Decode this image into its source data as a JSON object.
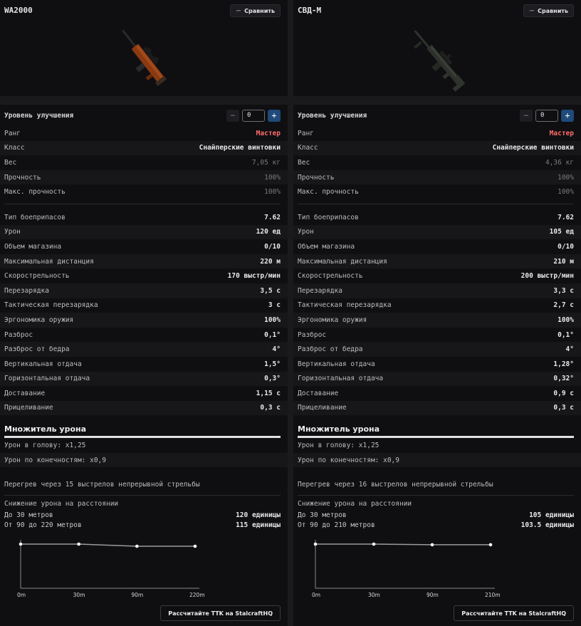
{
  "panels": [
    {
      "name": "WA2000",
      "compare_label": "Сравнить",
      "upgrade_label": "Уровень улучшения",
      "upgrade_value": "0",
      "rows_a": [
        {
          "label": "Ранг",
          "value": "Мастер",
          "kind": "rank"
        },
        {
          "label": "Класс",
          "value": "Снайперские винтовки",
          "kind": "bold"
        },
        {
          "label": "Вес",
          "value": "7,05 кг",
          "kind": "dim"
        },
        {
          "label": "Прочность",
          "value": "100%",
          "kind": "dim"
        },
        {
          "label": "Макс. прочность",
          "value": "100%",
          "kind": "dim"
        }
      ],
      "rows_b": [
        {
          "label": "Тип боеприпасов",
          "value": "7.62"
        },
        {
          "label": "Урон",
          "value": "120 ед"
        },
        {
          "label": "Объем магазина",
          "value": "0/10"
        },
        {
          "label": "Максимальная дистанция",
          "value": "220 м"
        },
        {
          "label": "Скорострельность",
          "value": "170 выстр/мин"
        },
        {
          "label": "Перезарядка",
          "value": "3,5 с"
        },
        {
          "label": "Тактическая перезарядка",
          "value": "3 с"
        },
        {
          "label": "Эргономика оружия",
          "value": "100%"
        },
        {
          "label": "Разброс",
          "value": "0,1°"
        },
        {
          "label": "Разброс от бедра",
          "value": "4°"
        },
        {
          "label": "Вертикальная отдача",
          "value": "1,5°"
        },
        {
          "label": "Горизонтальная отдача",
          "value": "0,3°"
        },
        {
          "label": "Доставание",
          "value": "1,15 с"
        },
        {
          "label": "Прицеливание",
          "value": "0,3 с"
        }
      ],
      "multiplier_title": "Множитель урона",
      "head_mult": "Урон в голову: x1,25",
      "limb_mult": "Урон по конечностям: x0,9",
      "overheat": "Перегрев через 15 выстрелов непрерывной стрельбы",
      "falloff_title": "Снижение урона на расстоянии",
      "falloff_rows": [
        {
          "label": "До 30 метров",
          "value": "120 единицы"
        },
        {
          "label": "От 90 до 220 метров",
          "value": "115 единицы"
        }
      ],
      "chart_data": {
        "type": "line",
        "x": [
          0,
          30,
          90,
          220
        ],
        "x_labels": [
          "0m",
          "30m",
          "90m",
          "220m"
        ],
        "y": [
          120,
          120,
          115,
          115
        ]
      },
      "ttk_label": "Рассчитайте TTK на StalcraftHQ",
      "weapon_icon": "rifle-wa2000-icon"
    },
    {
      "name": "СВД-М",
      "compare_label": "Сравнить",
      "upgrade_label": "Уровень улучшения",
      "upgrade_value": "0",
      "rows_a": [
        {
          "label": "Ранг",
          "value": "Мастер",
          "kind": "rank"
        },
        {
          "label": "Класс",
          "value": "Снайперские винтовки",
          "kind": "bold"
        },
        {
          "label": "Вес",
          "value": "4,36 кг",
          "kind": "dim"
        },
        {
          "label": "Прочность",
          "value": "100%",
          "kind": "dim"
        },
        {
          "label": "Макс. прочность",
          "value": "100%",
          "kind": "dim"
        }
      ],
      "rows_b": [
        {
          "label": "Тип боеприпасов",
          "value": "7.62"
        },
        {
          "label": "Урон",
          "value": "105 ед"
        },
        {
          "label": "Объем магазина",
          "value": "0/10"
        },
        {
          "label": "Максимальная дистанция",
          "value": "210 м"
        },
        {
          "label": "Скорострельность",
          "value": "200 выстр/мин"
        },
        {
          "label": "Перезарядка",
          "value": "3,3 с"
        },
        {
          "label": "Тактическая перезарядка",
          "value": "2,7 с"
        },
        {
          "label": "Эргономика оружия",
          "value": "100%"
        },
        {
          "label": "Разброс",
          "value": "0,1°"
        },
        {
          "label": "Разброс от бедра",
          "value": "4°"
        },
        {
          "label": "Вертикальная отдача",
          "value": "1,28°"
        },
        {
          "label": "Горизонтальная отдача",
          "value": "0,32°"
        },
        {
          "label": "Доставание",
          "value": "0,9 с"
        },
        {
          "label": "Прицеливание",
          "value": "0,3 с"
        }
      ],
      "multiplier_title": "Множитель урона",
      "head_mult": "Урон в голову: x1,25",
      "limb_mult": "Урон по конечностям: x0,9",
      "overheat": "Перегрев через 16 выстрелов непрерывной стрельбы",
      "falloff_title": "Снижение урона на расстоянии",
      "falloff_rows": [
        {
          "label": "До 30 метров",
          "value": "105 единицы"
        },
        {
          "label": "От 90 до 210 метров",
          "value": "103.5 единицы"
        }
      ],
      "chart_data": {
        "type": "line",
        "x": [
          0,
          30,
          90,
          210
        ],
        "x_labels": [
          "0m",
          "30m",
          "90m",
          "210m"
        ],
        "y": [
          105,
          105,
          103.5,
          103.5
        ]
      },
      "ttk_label": "Рассчитайте TTK на StalcraftHQ",
      "weapon_icon": "rifle-svd-m-icon"
    }
  ]
}
